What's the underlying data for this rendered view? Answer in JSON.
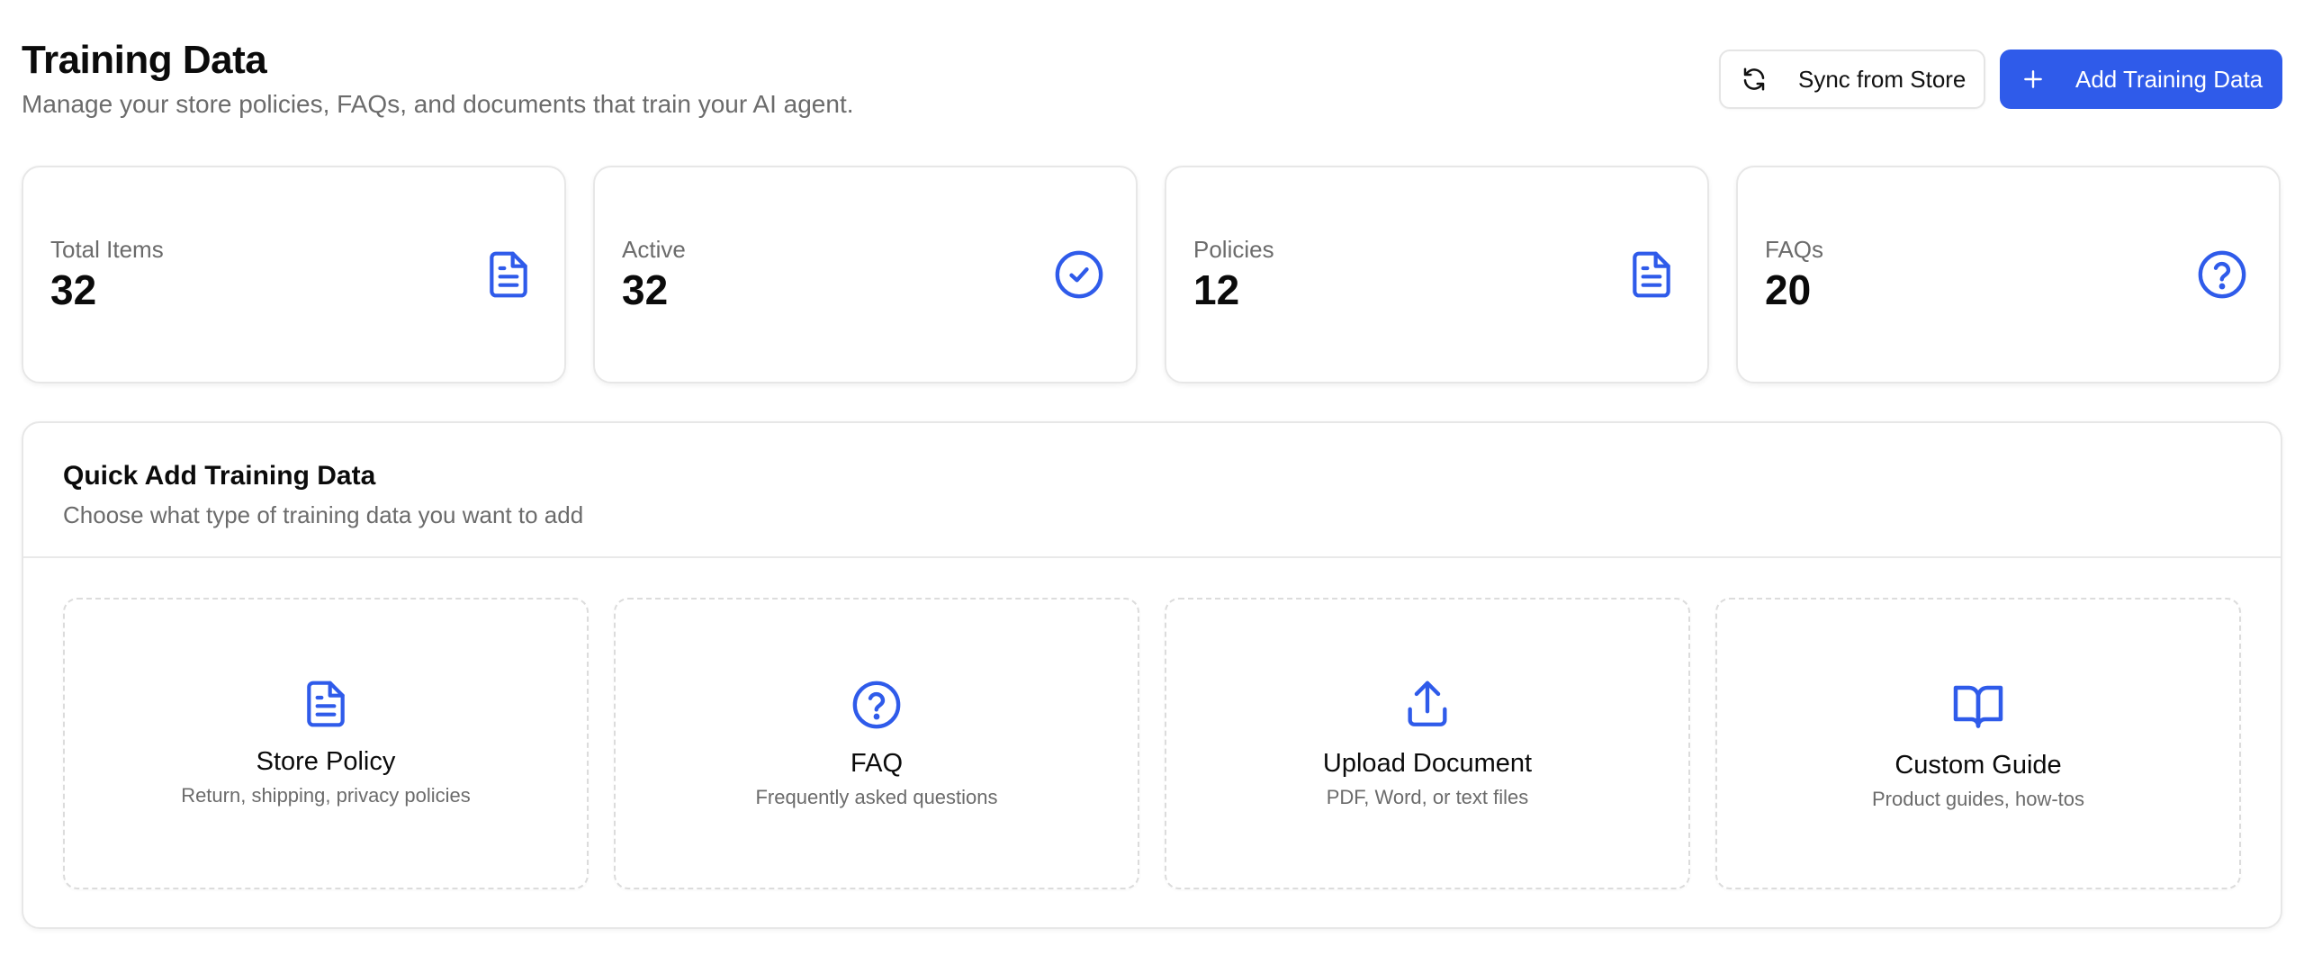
{
  "header": {
    "title": "Training Data",
    "subtitle": "Manage your store policies, FAQs, and documents that train your AI agent.",
    "sync_label": "Sync from Store",
    "add_label": "Add Training Data"
  },
  "stats": [
    {
      "label": "Total Items",
      "value": "32",
      "icon": "document-icon"
    },
    {
      "label": "Active",
      "value": "32",
      "icon": "check-circle-icon"
    },
    {
      "label": "Policies",
      "value": "12",
      "icon": "document-icon"
    },
    {
      "label": "FAQs",
      "value": "20",
      "icon": "question-circle-icon"
    }
  ],
  "quick_add": {
    "title": "Quick Add Training Data",
    "subtitle": "Choose what type of training data you want to add",
    "options": [
      {
        "title": "Store Policy",
        "description": "Return, shipping, privacy policies",
        "icon": "document-icon"
      },
      {
        "title": "FAQ",
        "description": "Frequently asked questions",
        "icon": "question-circle-icon"
      },
      {
        "title": "Upload Document",
        "description": "PDF, Word, or text files",
        "icon": "upload-icon"
      },
      {
        "title": "Custom Guide",
        "description": "Product guides, how-tos",
        "icon": "book-open-icon"
      }
    ]
  },
  "colors": {
    "accent": "#2f5bea",
    "border": "#e7e7e7",
    "muted_text": "#6b6b6b"
  }
}
